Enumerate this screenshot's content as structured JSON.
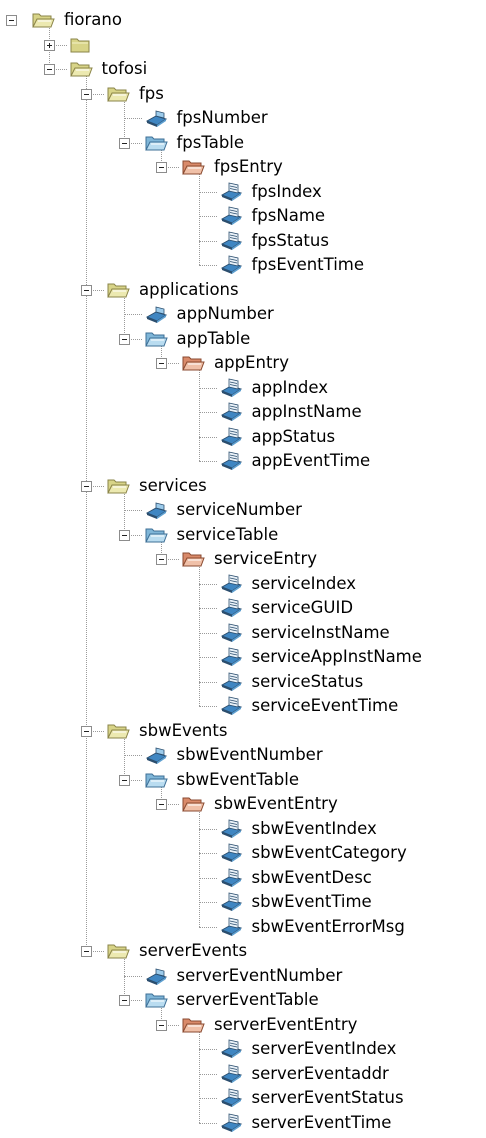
{
  "tree": {
    "label": "fiorano",
    "icon": "folder-open-icon",
    "expanded": true,
    "children": [
      {
        "label": "",
        "icon": "folder-closed-icon",
        "expanded": false,
        "children": []
      },
      {
        "label": "tofosi",
        "icon": "folder-open-icon",
        "expanded": true,
        "children": [
          {
            "label": "fps",
            "icon": "folder-open-icon",
            "expanded": true,
            "children": [
              {
                "label": "fpsNumber",
                "icon": "scalar-leaf-icon"
              },
              {
                "label": "fpsTable",
                "icon": "table-folder-icon",
                "expanded": true,
                "children": [
                  {
                    "label": "fpsEntry",
                    "icon": "entry-folder-icon",
                    "expanded": true,
                    "children": [
                      {
                        "label": "fpsIndex",
                        "icon": "column-leaf-icon"
                      },
                      {
                        "label": "fpsName",
                        "icon": "column-leaf-icon"
                      },
                      {
                        "label": "fpsStatus",
                        "icon": "column-leaf-icon"
                      },
                      {
                        "label": "fpsEventTime",
                        "icon": "column-leaf-icon"
                      }
                    ]
                  }
                ]
              }
            ]
          },
          {
            "label": "applications",
            "icon": "folder-open-icon",
            "expanded": true,
            "children": [
              {
                "label": "appNumber",
                "icon": "scalar-leaf-icon"
              },
              {
                "label": "appTable",
                "icon": "table-folder-icon",
                "expanded": true,
                "children": [
                  {
                    "label": "appEntry",
                    "icon": "entry-folder-icon",
                    "expanded": true,
                    "children": [
                      {
                        "label": "appIndex",
                        "icon": "column-leaf-icon"
                      },
                      {
                        "label": "appInstName",
                        "icon": "column-leaf-icon"
                      },
                      {
                        "label": "appStatus",
                        "icon": "column-leaf-icon"
                      },
                      {
                        "label": "appEventTime",
                        "icon": "column-leaf-icon"
                      }
                    ]
                  }
                ]
              }
            ]
          },
          {
            "label": "services",
            "icon": "folder-open-icon",
            "expanded": true,
            "children": [
              {
                "label": "serviceNumber",
                "icon": "scalar-leaf-icon"
              },
              {
                "label": "serviceTable",
                "icon": "table-folder-icon",
                "expanded": true,
                "children": [
                  {
                    "label": "serviceEntry",
                    "icon": "entry-folder-icon",
                    "expanded": true,
                    "children": [
                      {
                        "label": "serviceIndex",
                        "icon": "column-leaf-icon"
                      },
                      {
                        "label": "serviceGUID",
                        "icon": "column-leaf-icon"
                      },
                      {
                        "label": "serviceInstName",
                        "icon": "column-leaf-icon"
                      },
                      {
                        "label": "serviceAppInstName",
                        "icon": "column-leaf-icon"
                      },
                      {
                        "label": "serviceStatus",
                        "icon": "column-leaf-icon"
                      },
                      {
                        "label": "serviceEventTime",
                        "icon": "column-leaf-icon"
                      }
                    ]
                  }
                ]
              }
            ]
          },
          {
            "label": "sbwEvents",
            "icon": "folder-open-icon",
            "expanded": true,
            "children": [
              {
                "label": "sbwEventNumber",
                "icon": "scalar-leaf-icon"
              },
              {
                "label": "sbwEventTable",
                "icon": "table-folder-icon",
                "expanded": true,
                "children": [
                  {
                    "label": "sbwEventEntry",
                    "icon": "entry-folder-icon",
                    "expanded": true,
                    "children": [
                      {
                        "label": "sbwEventIndex",
                        "icon": "column-leaf-icon"
                      },
                      {
                        "label": "sbwEventCategory",
                        "icon": "column-leaf-icon"
                      },
                      {
                        "label": "sbwEventDesc",
                        "icon": "column-leaf-icon"
                      },
                      {
                        "label": "sbwEventTime",
                        "icon": "column-leaf-icon"
                      },
                      {
                        "label": "sbwEventErrorMsg",
                        "icon": "column-leaf-icon"
                      }
                    ]
                  }
                ]
              }
            ]
          },
          {
            "label": "serverEvents",
            "icon": "folder-open-icon",
            "expanded": true,
            "children": [
              {
                "label": "serverEventNumber",
                "icon": "scalar-leaf-icon"
              },
              {
                "label": "serverEventTable",
                "icon": "table-folder-icon",
                "expanded": true,
                "children": [
                  {
                    "label": "serverEventEntry",
                    "icon": "entry-folder-icon",
                    "expanded": true,
                    "children": [
                      {
                        "label": "serverEventIndex",
                        "icon": "column-leaf-icon"
                      },
                      {
                        "label": "serverEventaddr",
                        "icon": "column-leaf-icon"
                      },
                      {
                        "label": "serverEventStatus",
                        "icon": "column-leaf-icon"
                      },
                      {
                        "label": "serverEventTime",
                        "icon": "column-leaf-icon"
                      }
                    ]
                  }
                ]
              }
            ]
          }
        ]
      }
    ]
  },
  "colors": {
    "folder_yellow": "#d8d488",
    "folder_yellow_dark": "#8a8448",
    "table_blue": "#7fb6d8",
    "table_blue_dark": "#3d6f96",
    "entry_red": "#d98a6a",
    "entry_red_dark": "#8a4a30",
    "leaf_blue": "#3f86c2",
    "leaf_dark": "#2b4e6e",
    "tree_line": "#9a9a9a"
  }
}
